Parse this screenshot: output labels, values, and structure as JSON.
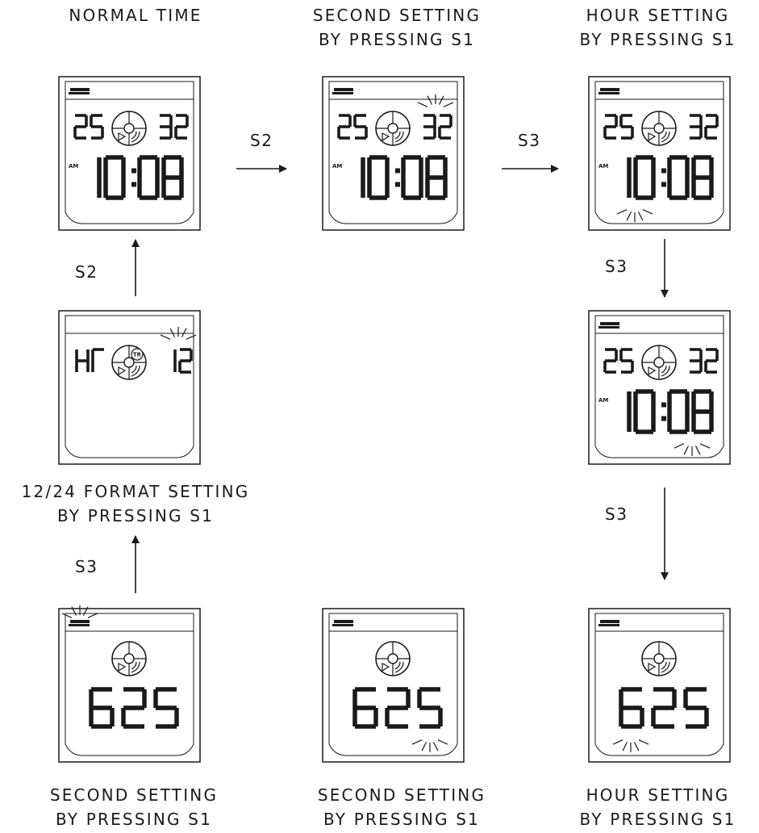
{
  "diagram": {
    "labels": [
      {
        "id": "normal",
        "lines": [
          "NORMAL TIME"
        ]
      },
      {
        "id": "sec_top",
        "lines": [
          "SECOND SETTING",
          "BY PRESSING S1"
        ]
      },
      {
        "id": "hour_top",
        "lines": [
          "HOUR SETTING",
          "BY PRESSING S1"
        ]
      },
      {
        "id": "fmt",
        "lines": [
          "12/24 FORMAT SETTING",
          "BY PRESSING S1"
        ]
      },
      {
        "id": "sec_bl",
        "lines": [
          "SECOND SETTING",
          "BY PRESSING S1"
        ]
      },
      {
        "id": "sec_bm",
        "lines": [
          "SECOND SETTING",
          "BY PRESSING S1"
        ]
      },
      {
        "id": "hour_br",
        "lines": [
          "HOUR SETTING",
          "BY PRESSING S1"
        ]
      }
    ],
    "steps": [
      {
        "id": "s2_top",
        "text": "S2"
      },
      {
        "id": "s3_top",
        "text": "S3"
      },
      {
        "id": "s2_left",
        "text": "S2"
      },
      {
        "id": "s3_r1",
        "text": "S3"
      },
      {
        "id": "s3_r2",
        "text": "S3"
      },
      {
        "id": "s3_left",
        "text": "S3"
      }
    ],
    "screens": [
      {
        "id": "normal",
        "mode": "time",
        "left": "25",
        "right": "32",
        "ampm": "AM",
        "time": "10:08",
        "blink": "none"
      },
      {
        "id": "sec_top",
        "mode": "time",
        "left": "25",
        "right": "32",
        "ampm": "AM",
        "time": "10:08",
        "blink": "small_right"
      },
      {
        "id": "hour_top",
        "mode": "time",
        "left": "25",
        "right": "32",
        "ampm": "AM",
        "time": "10:08",
        "blink": "hours"
      },
      {
        "id": "mid_r",
        "mode": "time",
        "left": "25",
        "right": "32",
        "ampm": "AM",
        "time": "10:08",
        "blink": "minutes"
      },
      {
        "id": "fmt",
        "mode": "format",
        "left": "HR",
        "right": "12",
        "badge": "TR",
        "blink": "small_right"
      },
      {
        "id": "sec_bl",
        "mode": "count",
        "big": "625",
        "blink": "battery"
      },
      {
        "id": "sec_bm",
        "mode": "count",
        "big": "625",
        "blink": "big_right"
      },
      {
        "id": "hour_br",
        "mode": "count",
        "big": "625",
        "blink": "big_left"
      }
    ]
  }
}
